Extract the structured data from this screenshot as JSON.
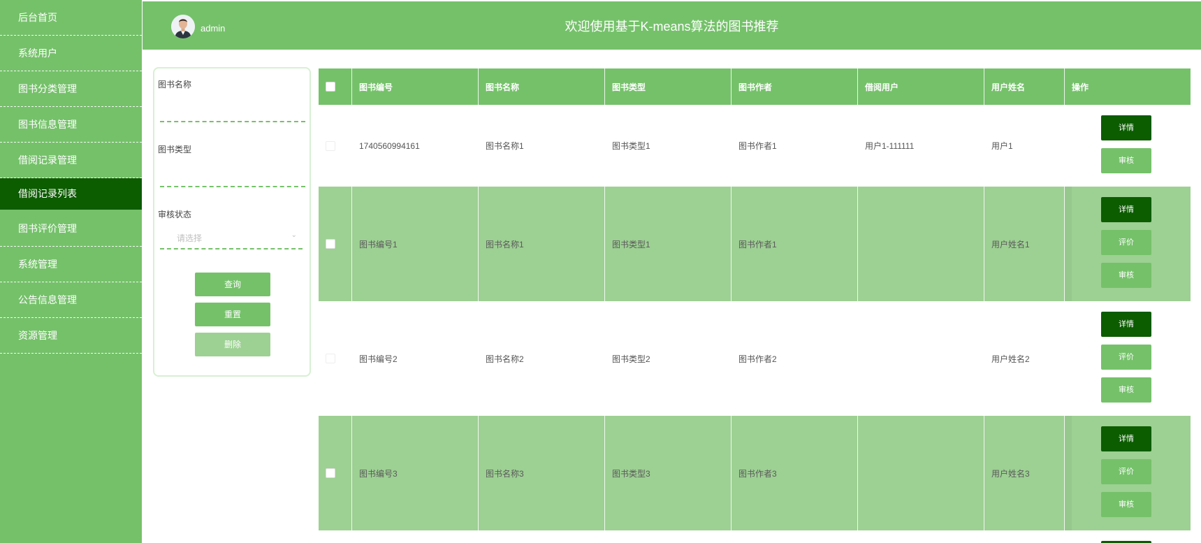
{
  "sidebar": {
    "items": [
      {
        "label": "后台首页"
      },
      {
        "label": "系统用户"
      },
      {
        "label": "图书分类管理"
      },
      {
        "label": "图书信息管理"
      },
      {
        "label": "借阅记录管理"
      },
      {
        "label": "借阅记录列表",
        "active": true
      },
      {
        "label": "图书评价管理"
      },
      {
        "label": "系统管理"
      },
      {
        "label": "公告信息管理"
      },
      {
        "label": "资源管理"
      }
    ]
  },
  "header": {
    "username": "admin",
    "title": "欢迎使用基于K-means算法的图书推荐"
  },
  "search": {
    "book_name_label": "图书名称",
    "book_name_value": "",
    "book_type_label": "图书类型",
    "book_type_value": "",
    "audit_status_label": "审核状态",
    "audit_status_placeholder": "请选择",
    "query_button": "查询",
    "reset_button": "重置",
    "delete_button": "删除"
  },
  "table": {
    "columns": [
      "图书编号",
      "图书名称",
      "图书类型",
      "图书作者",
      "借阅用户",
      "用户姓名",
      "操作"
    ],
    "rows": [
      {
        "id": "1740560994161",
        "name": "图书名称1",
        "type": "图书类型1",
        "author": "图书作者1",
        "borrower": "用户1-111111",
        "user_name": "用户1",
        "actions": [
          "详情",
          "审核"
        ]
      },
      {
        "id": "图书编号1",
        "name": "图书名称1",
        "type": "图书类型1",
        "author": "图书作者1",
        "borrower": "",
        "user_name": "用户姓名1",
        "actions": [
          "详情",
          "评价",
          "审核"
        ]
      },
      {
        "id": "图书编号2",
        "name": "图书名称2",
        "type": "图书类型2",
        "author": "图书作者2",
        "borrower": "",
        "user_name": "用户姓名2",
        "actions": [
          "详情",
          "评价",
          "审核"
        ]
      },
      {
        "id": "图书编号3",
        "name": "图书名称3",
        "type": "图书类型3",
        "author": "图书作者3",
        "borrower": "",
        "user_name": "用户姓名3",
        "actions": [
          "详情",
          "评价",
          "审核"
        ]
      }
    ]
  },
  "colors": {
    "primary": "#75c16a",
    "dark": "#0c5c00",
    "light": "#9dd093"
  }
}
